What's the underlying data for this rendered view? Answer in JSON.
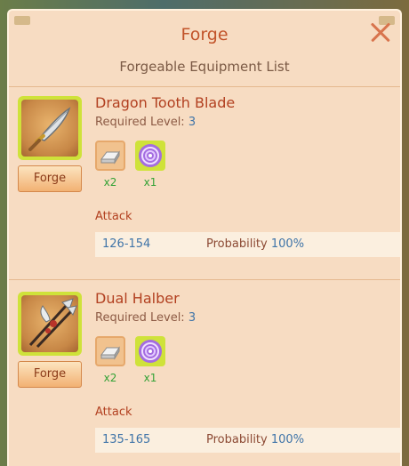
{
  "dialog": {
    "title": "Forge",
    "subtitle": "Forgeable Equipment List"
  },
  "colors": {
    "panel_bg": "#f7dcc2",
    "title": "#c2542a",
    "item_name": "#b24020",
    "value_blue": "#3f74a8",
    "count_green": "#34a236",
    "frame_lime": "#cfe23a"
  },
  "items": [
    {
      "name": "Dragon Tooth Blade",
      "icon": "curved-blade-icon",
      "required_level_label": "Required Level:",
      "required_level": "3",
      "forge_label": "Forge",
      "materials": [
        {
          "icon": "silver-ingot-icon",
          "count": "x2"
        },
        {
          "icon": "purple-swirl-orb-icon",
          "count": "x1"
        }
      ],
      "stat_label": "Attack",
      "stat_range": "126-154",
      "probability_label": "Probability",
      "probability": "100%"
    },
    {
      "name": "Dual Halber",
      "icon": "crossed-halberds-icon",
      "required_level_label": "Required Level:",
      "required_level": "3",
      "forge_label": "Forge",
      "materials": [
        {
          "icon": "silver-ingot-icon",
          "count": "x2"
        },
        {
          "icon": "purple-swirl-orb-icon",
          "count": "x1"
        }
      ],
      "stat_label": "Attack",
      "stat_range": "135-165",
      "probability_label": "Probability",
      "probability": "100%"
    }
  ]
}
